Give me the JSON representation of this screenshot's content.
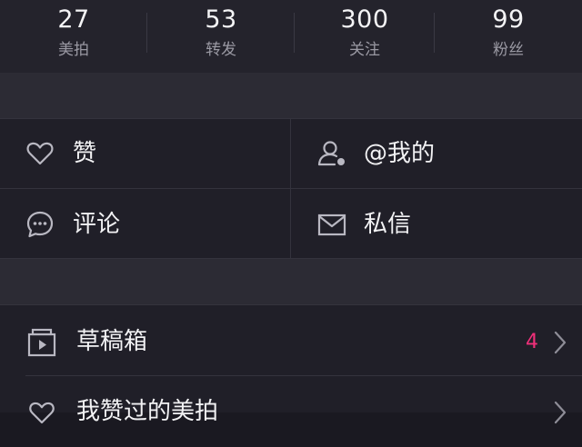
{
  "stats": [
    {
      "count": "27",
      "label": "美拍"
    },
    {
      "count": "53",
      "label": "转发"
    },
    {
      "count": "300",
      "label": "关注"
    },
    {
      "count": "99",
      "label": "粉丝"
    }
  ],
  "grid": {
    "like": "赞",
    "mention": "@我的",
    "comment": "评论",
    "message": "私信"
  },
  "list": {
    "drafts": {
      "label": "草稿箱",
      "badge": "4"
    },
    "liked": {
      "label": "我赞过的美拍"
    }
  },
  "colors": {
    "background": "#1a1921",
    "panel": "#201f28",
    "badge": "#f0307a",
    "icon": "#b9b8c2"
  }
}
